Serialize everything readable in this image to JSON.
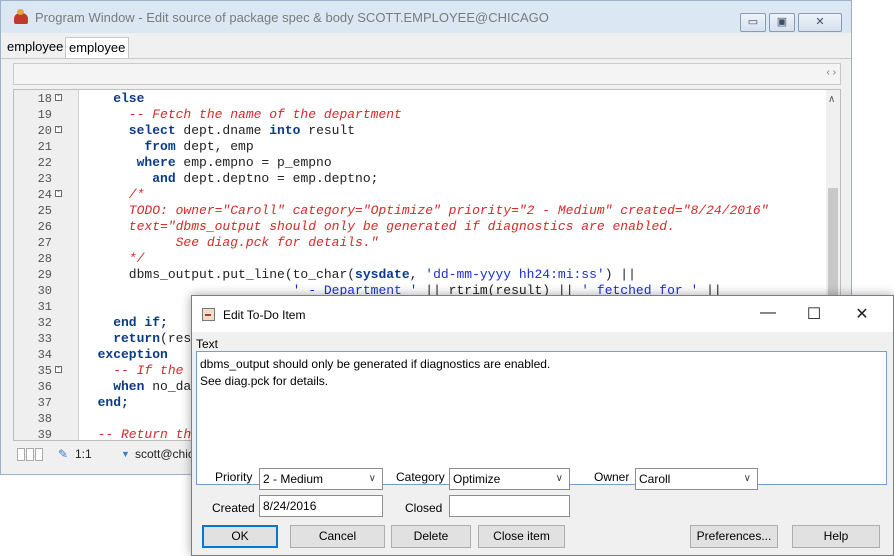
{
  "program_window": {
    "title": "Program Window - Edit source of package spec & body SCOTT.EMPLOYEE@CHICAGO",
    "tabs": [
      "employee",
      "employee"
    ],
    "window_controls": {
      "minimize": "▭",
      "maximize": "▣",
      "close": "✕"
    },
    "scroll_arrows": "‹ ›"
  },
  "editor": {
    "lines": [
      {
        "n": "18",
        "fold": "-",
        "code": [
          [
            "kw",
            "    else"
          ]
        ]
      },
      {
        "n": "19",
        "fold": "",
        "code": [
          [
            "cm",
            "      -- Fetch the name of the department"
          ]
        ]
      },
      {
        "n": "20",
        "fold": "-",
        "code": [
          [
            "kw",
            "      select "
          ],
          [
            "pl",
            "dept.dname "
          ],
          [
            "kw",
            "into "
          ],
          [
            "pl",
            "result"
          ]
        ]
      },
      {
        "n": "21",
        "fold": "",
        "code": [
          [
            "kw",
            "        from "
          ],
          [
            "pl",
            "dept, emp"
          ]
        ]
      },
      {
        "n": "22",
        "fold": "",
        "code": [
          [
            "kw",
            "       where "
          ],
          [
            "pl",
            "emp.empno = p_empno"
          ]
        ]
      },
      {
        "n": "23",
        "fold": "",
        "code": [
          [
            "kw",
            "         and "
          ],
          [
            "pl",
            "dept.deptno = emp.deptno;"
          ]
        ]
      },
      {
        "n": "24",
        "fold": "-",
        "code": [
          [
            "cm",
            "      /*"
          ]
        ]
      },
      {
        "n": "25",
        "fold": "",
        "code": [
          [
            "cm",
            "      TODO: owner=\"Caroll\" category=\"Optimize\" priority=\"2 - Medium\" created=\"8/24/2016\""
          ]
        ]
      },
      {
        "n": "26",
        "fold": "",
        "code": [
          [
            "cm",
            "      text=\"dbms_output should only be generated if diagnostics are enabled."
          ]
        ]
      },
      {
        "n": "27",
        "fold": "",
        "code": [
          [
            "cm",
            "            See diag.pck for details.\""
          ]
        ]
      },
      {
        "n": "28",
        "fold": "",
        "code": [
          [
            "cm",
            "      */"
          ]
        ]
      },
      {
        "n": "29",
        "fold": "",
        "code": [
          [
            "pl",
            "      dbms_output.put_line(to_char("
          ],
          [
            "kw",
            "sysdate"
          ],
          [
            "pl",
            ", "
          ],
          [
            "str",
            "'dd-mm-yyyy hh24:mi:ss'"
          ],
          [
            "pl",
            ") ||"
          ]
        ]
      },
      {
        "n": "30",
        "fold": "",
        "code": [
          [
            "str",
            "                           ' - Department '"
          ],
          [
            "pl",
            " || rtrim(result) || "
          ],
          [
            "str",
            "' fetched for '"
          ],
          [
            "pl",
            " ||"
          ]
        ]
      },
      {
        "n": "31",
        "fold": "",
        "code": [
          [
            "pl",
            ""
          ]
        ]
      },
      {
        "n": "32",
        "fold": "",
        "code": [
          [
            "kw",
            "    end if;"
          ]
        ]
      },
      {
        "n": "33",
        "fold": "",
        "code": [
          [
            "kw",
            "    return"
          ],
          [
            "pl",
            "(res"
          ]
        ]
      },
      {
        "n": "34",
        "fold": "",
        "code": [
          [
            "kw",
            "  exception"
          ]
        ]
      },
      {
        "n": "35",
        "fold": "-",
        "code": [
          [
            "cm",
            "    -- If the"
          ]
        ]
      },
      {
        "n": "36",
        "fold": "",
        "code": [
          [
            "kw",
            "    when "
          ],
          [
            "pl",
            "no_da"
          ]
        ]
      },
      {
        "n": "37",
        "fold": "",
        "code": [
          [
            "kw",
            "  end;"
          ]
        ]
      },
      {
        "n": "38",
        "fold": "",
        "code": [
          [
            "pl",
            ""
          ]
        ]
      },
      {
        "n": "39",
        "fold": "",
        "code": [
          [
            "cm",
            "  -- Return th"
          ]
        ]
      }
    ],
    "scroll_up": "∧"
  },
  "statusbar": {
    "position": "1:1",
    "connection": "scott@chic"
  },
  "dialog": {
    "title": "Edit To-Do Item",
    "controls": {
      "minimize": "—",
      "maximize": "☐",
      "close": "✕"
    },
    "text_label": "Text",
    "text_lines": [
      "dbms_output should only be generated if diagnostics are enabled.",
      "See diag.pck for details."
    ],
    "priority_label": "Priority",
    "priority_value": "2 - Medium",
    "category_label": "Category",
    "category_value": "Optimize",
    "owner_label": "Owner",
    "owner_value": "Caroll",
    "created_label": "Created",
    "created_value": "8/24/2016",
    "closed_label": "Closed",
    "closed_value": "",
    "buttons": {
      "ok": "OK",
      "cancel": "Cancel",
      "delete": "Delete",
      "close_item": "Close item",
      "preferences": "Preferences...",
      "help": "Help"
    }
  }
}
